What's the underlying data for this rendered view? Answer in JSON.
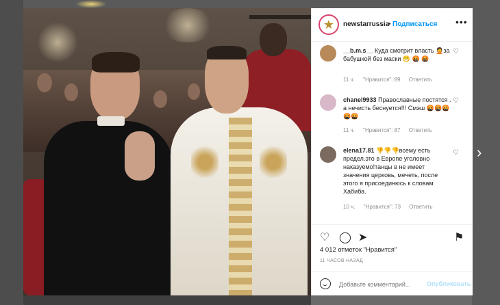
{
  "post": {
    "username": "newstarrussia",
    "separator": "•",
    "follow_label": "Подписаться",
    "more_icon": "more-horizontal-icon",
    "likes_count": "4 012 отметок \"Нравится\"",
    "time_ago": "11 ЧАСОВ НАЗАД"
  },
  "comments": [
    {
      "user": "__b.m.s__",
      "text": "Куда смотрит власть 🤦за бабушкой без маски 😁 🤬 🤬",
      "time": "11 ч.",
      "likes": "\"Нравится\": 89",
      "reply": "Ответить",
      "avatar_color": "#b88a5a"
    },
    {
      "user": "chanel9933",
      "text": "Православные постятся . а нечисть беснуется!!! Смэш 🤬🤬🤬🤬🤬",
      "time": "11 ч.",
      "likes": "\"Нравится\": 87",
      "reply": "Ответить",
      "avatar_color": "#d8b8c8"
    },
    {
      "user": "elena17.81",
      "text": "👎👎👎всему есть предел.это в Европе уголовно наказуемо!танцы в не имеет значения церковь, мечеть, после этого я присоединюсь к словам Хабиба.",
      "time": "10 ч.",
      "likes": "\"Нравится\": 73",
      "reply": "Ответить",
      "avatar_color": "#7a6a60"
    }
  ],
  "composer": {
    "placeholder": "Добавьте комментарий...",
    "publish_label": "Опубликовать"
  },
  "colors": {
    "accent_blue": "#0095f6",
    "publish_disabled": "#b2dffc",
    "meta_gray": "#8e8e8e"
  }
}
